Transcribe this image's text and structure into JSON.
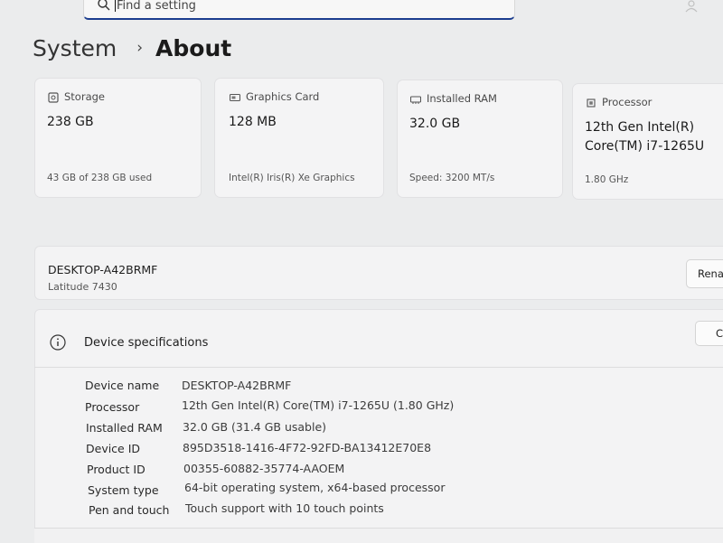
{
  "search": {
    "placeholder": "Find a setting"
  },
  "breadcrumb": {
    "parent": "System",
    "separator": "›",
    "current": "About"
  },
  "cards": [
    {
      "icon": "storage-icon",
      "label": "Storage",
      "value": "238 GB",
      "sub": "43 GB of 238 GB used"
    },
    {
      "icon": "graphics-card-icon",
      "label": "Graphics Card",
      "value": "128 MB",
      "sub": "Intel(R) Iris(R) Xe Graphics"
    },
    {
      "icon": "ram-icon",
      "label": "Installed RAM",
      "value": "32.0 GB",
      "sub": "Speed: 3200 MT/s"
    },
    {
      "icon": "processor-icon",
      "label": "Processor",
      "value_line1": "12th Gen Intel(R)",
      "value_line2": "Core(TM) i7-1265U",
      "sub": "1.80 GHz"
    }
  ],
  "device": {
    "name": "DESKTOP-A42BRMF",
    "model": "Latitude 7430",
    "rename_button": "Renar"
  },
  "specs": {
    "title": "Device specifications",
    "copy_button": "C",
    "rows": [
      {
        "label": "Device name",
        "value": "DESKTOP-A42BRMF"
      },
      {
        "label": "Processor",
        "value": "12th Gen Intel(R) Core(TM) i7-1265U (1.80 GHz)"
      },
      {
        "label": "Installed RAM",
        "value": "32.0 GB (31.4 GB usable)"
      },
      {
        "label": "Device ID",
        "value": "895D3518-1416-4F72-92FD-BA13412E70E8"
      },
      {
        "label": "Product ID",
        "value": "00355-60882-35774-AAOEM"
      },
      {
        "label": "System type",
        "value": "64-bit operating system, x64-based processor"
      },
      {
        "label": "Pen and touch",
        "value": "Touch support with 10 touch points"
      }
    ]
  },
  "colors": {
    "page_background": "#ebeced",
    "card_background": "#f4f4f5",
    "search_accent": "#1b3d8f"
  }
}
